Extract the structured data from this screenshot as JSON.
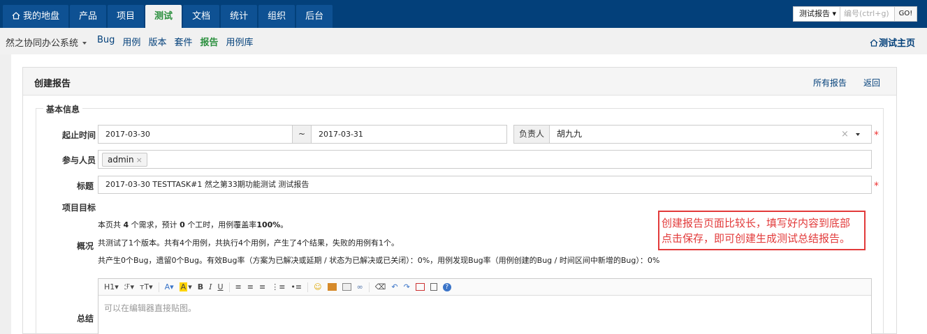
{
  "topnav": {
    "tabs": [
      {
        "label": "我的地盘",
        "active": false
      },
      {
        "label": "产品",
        "active": false
      },
      {
        "label": "项目",
        "active": false
      },
      {
        "label": "测试",
        "active": true
      },
      {
        "label": "文档",
        "active": false
      },
      {
        "label": "统计",
        "active": false
      },
      {
        "label": "组织",
        "active": false
      },
      {
        "label": "后台",
        "active": false
      }
    ],
    "search": {
      "select": "测试报告",
      "placeholder": "编号(ctrl+g)",
      "go": "GO!"
    }
  },
  "subnav": {
    "product": "然之协同办公系统",
    "links": [
      {
        "label": "Bug",
        "active": false
      },
      {
        "label": "用例",
        "active": false
      },
      {
        "label": "版本",
        "active": false
      },
      {
        "label": "套件",
        "active": false
      },
      {
        "label": "报告",
        "active": true
      },
      {
        "label": "用例库",
        "active": false
      }
    ],
    "home": "测试主页"
  },
  "panel": {
    "title": "创建报告",
    "all_reports": "所有报告",
    "back": "返回"
  },
  "form": {
    "legend": "基本信息",
    "period_label": "起止时间",
    "start": "2017-03-30",
    "separator": "~",
    "end": "2017-03-31",
    "owner_label": "负责人",
    "owner": "胡九九",
    "members_label": "参与人员",
    "member": "admin",
    "title_label": "标题",
    "title": "2017-03-30 TESTTASK#1 然之第33期功能测试 测试报告",
    "goal_label": "项目目标",
    "goal_prefix": "本页共",
    "goal_count": "4",
    "goal_mid": "个需求，预计",
    "goal_hours": "0",
    "goal_mid2": "个工时，用例覆盖率",
    "goal_rate": "100%",
    "goal_end": "。",
    "overview_label": "概况",
    "overview1": "共测试了1个版本。共有4个用例，共执行4个用例，产生了4个结果，失败的用例有1个。",
    "overview2": "共产生0个Bug，遗留0个Bug。有效Bug率（方案为已解决或延期 / 状态为已解决或已关闭）：0%，用例发现Bug率（用例创建的Bug / 时间区间中新增的Bug）：0%",
    "summary_label": "总结",
    "editor_placeholder": "可以在编辑器直接贴图。"
  },
  "annotation": {
    "line1": "创建报告页面比较长，填写好内容到底部",
    "line2": "点击保存，即可创建生成测试总结报告。"
  },
  "colors": {
    "nav_bg": "#03407a",
    "active_green": "#2a8f3d",
    "annotation_red": "#e23a3a"
  }
}
